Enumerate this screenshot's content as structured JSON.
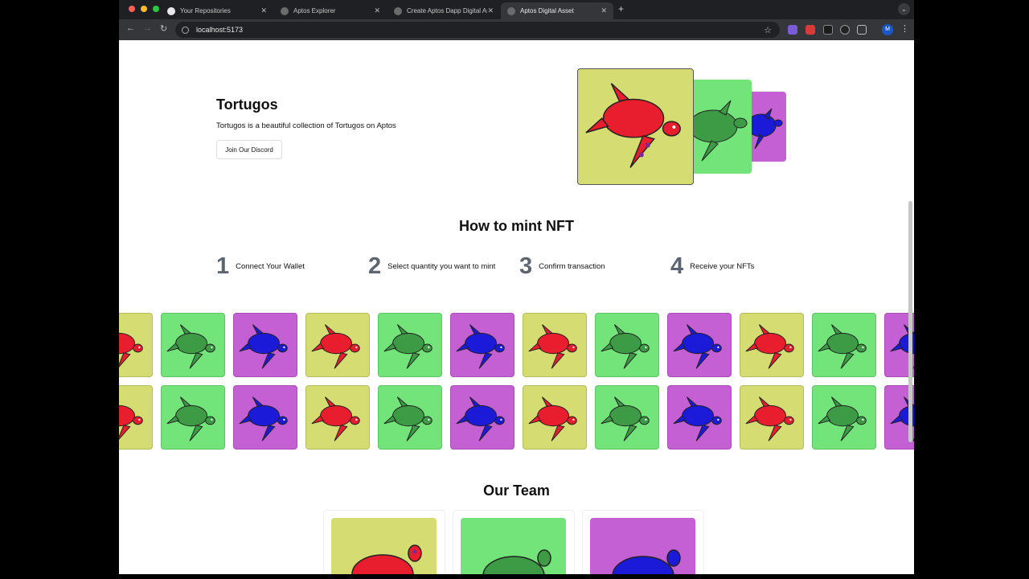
{
  "browser": {
    "tabs": [
      {
        "label": "Your Repositories"
      },
      {
        "label": "Aptos Explorer"
      },
      {
        "label": "Create Aptos Dapp Digital As"
      },
      {
        "label": "Aptos Digital Asset"
      }
    ],
    "url": "localhost:5173",
    "profile_initial": "M"
  },
  "hero": {
    "title": "Tortugos",
    "description": "Tortugos is a beautiful collection of Tortugos on Aptos",
    "discord_button": "Join Our Discord"
  },
  "how_to_mint": {
    "title": "How to mint NFT",
    "steps": [
      {
        "number": "1",
        "label": "Connect Your Wallet"
      },
      {
        "number": "2",
        "label": "Select quantity you want to mint"
      },
      {
        "number": "3",
        "label": "Confirm transaction"
      },
      {
        "number": "4",
        "label": "Receive your NFTs"
      }
    ]
  },
  "team": {
    "title": "Our Team"
  },
  "colors": {
    "yellow_bg": "#d4dc72",
    "green_bg": "#72e47a",
    "purple_bg": "#c45fd4",
    "red_turtle": "#e81d2d",
    "green_turtle": "#3d9a45",
    "blue_turtle": "#1a1ad8"
  },
  "icons": {
    "tab_github": "github-icon",
    "tab_site": "globe-icon",
    "back": "arrow-left-icon",
    "forward": "arrow-right-icon",
    "reload": "reload-icon",
    "bookmark": "star-icon",
    "extensions": "puzzle-icon",
    "menu": "kebab-icon",
    "nft": "turtle-icon"
  }
}
